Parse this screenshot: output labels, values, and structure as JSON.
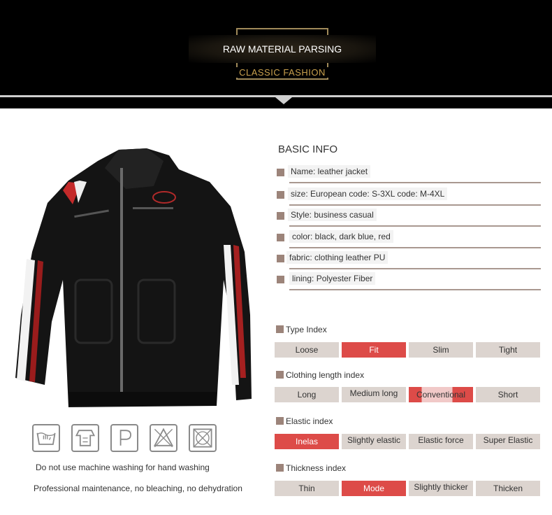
{
  "banner": {
    "title": "RAW MATERIAL PARSING",
    "subtitle": "CLASSIC FASHION"
  },
  "basic_info": {
    "title": "BASIC INFO",
    "rows": [
      {
        "label": "Name: leather jacket"
      },
      {
        "label": "size:  European code: S-3XL code: M-4XL"
      },
      {
        "label": "Style: business casual"
      },
      {
        "label": "color: black, dark blue, red"
      },
      {
        "label": "fabric: clothing leather PU"
      },
      {
        "label": "lining: Polyester Fiber"
      }
    ]
  },
  "indices": {
    "type": {
      "title": "Type Index",
      "options": [
        "Loose",
        "Fit",
        "Slim",
        "Tight"
      ],
      "selected": "Fit"
    },
    "length": {
      "title": "Clothing length index",
      "options": [
        "Long",
        "Medium long",
        "Conventional",
        "Short"
      ],
      "selected": "Conventional"
    },
    "elastic": {
      "title": "Elastic index",
      "options": [
        "Inelas",
        "Slightly elastic",
        "Elastic force",
        "Super Elastic"
      ],
      "selected": "Inelas"
    },
    "thickness": {
      "title": "Thickness index",
      "options": [
        "Thin",
        "Mode",
        "Slightly thicker",
        "Thicken"
      ],
      "selected": "Mode"
    }
  },
  "care": {
    "icons": [
      "hand-wash-icon",
      "no-tumble-dry-icon",
      "professional-dry-clean-icon",
      "no-bleach-icon",
      "no-dry-icon"
    ],
    "line1": "Do not use machine washing for hand washing",
    "line2": "Professional maintenance, no bleaching, no dehydration"
  },
  "colors": {
    "accent": "#dd4b48",
    "cell": "#dcd4cf",
    "bullet": "#9c847a",
    "gold": "#c9a14e"
  }
}
